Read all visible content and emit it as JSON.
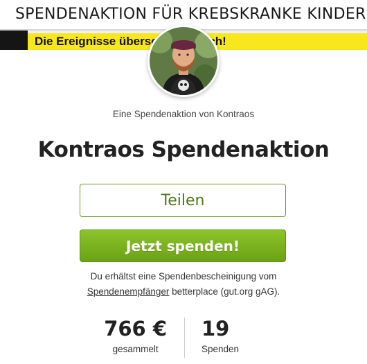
{
  "banner": {
    "title": "SPENDENAKTION FÜR KREBSKRANKE KINDER",
    "subtitle": "Die Ereignisse überschlagen sich!",
    "strip_color": "#f8e71c"
  },
  "avatar": {
    "icon": "profile-photo"
  },
  "fundraiser": {
    "by_line": "Eine Spendenaktion von Kontraos",
    "title": "Kontraos Spendenaktion"
  },
  "actions": {
    "share_label": "Teilen",
    "donate_label": "Jetzt spenden!",
    "accent": "#7cb41f"
  },
  "receipt": {
    "line1": "Du erhältst eine Spendenbescheinigung vom",
    "link": "Spendenempfänger",
    "line2_rest": " betterplace (gut.org gAG)."
  },
  "stats": {
    "collected_value": "766 €",
    "collected_label": "gesammelt",
    "donations_value": "19",
    "donations_label": "Spenden"
  }
}
